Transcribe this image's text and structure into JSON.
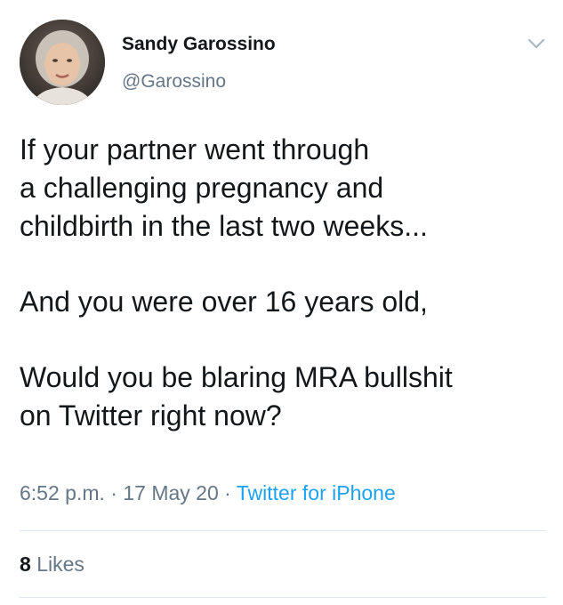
{
  "user": {
    "display_name": "Sandy Garossino",
    "handle": "@Garossino",
    "avatar_icon": "profile-photo"
  },
  "menu_icon": "chevron-down-icon",
  "tweet": {
    "lines": [
      "If your partner went through",
      "a challenging pregnancy and",
      "childbirth in the last two weeks...",
      "And you were over 16 years old,",
      "Would you be blaring MRA bullshit",
      "on Twitter right now?"
    ]
  },
  "meta": {
    "time": "6:52 p.m.",
    "separator": " · ",
    "date": "17 May 20",
    "source": "Twitter for iPhone"
  },
  "engagement": {
    "likes_count": "8",
    "likes_label": "Likes"
  },
  "colors": {
    "text": "#14171a",
    "secondary": "#657786",
    "link": "#1da1f2",
    "divider": "#e1e8ed"
  }
}
